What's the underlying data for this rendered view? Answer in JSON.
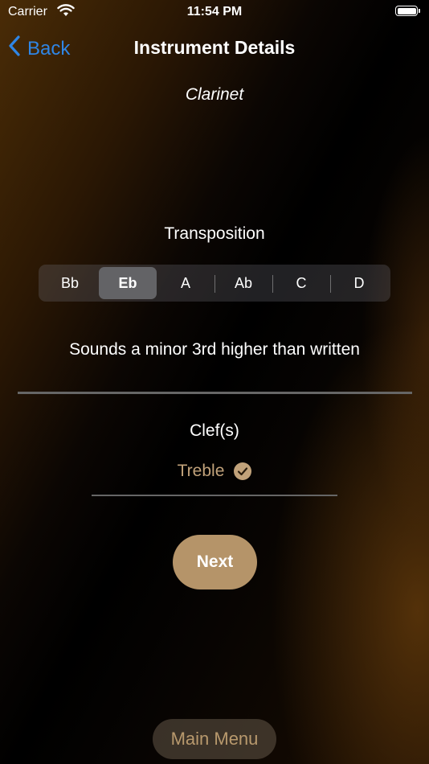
{
  "status_bar": {
    "carrier": "Carrier",
    "time": "11:54 PM"
  },
  "nav": {
    "back_label": "Back",
    "title": "Instrument Details"
  },
  "instrument": "Clarinet",
  "transposition": {
    "label": "Transposition",
    "options": [
      "Bb",
      "Eb",
      "A",
      "Ab",
      "C",
      "D"
    ],
    "selected": "Eb",
    "description": "Sounds a minor 3rd higher than written"
  },
  "clefs": {
    "label": "Clef(s)",
    "items": [
      {
        "name": "Treble",
        "checked": true
      }
    ]
  },
  "next_label": "Next",
  "main_menu_label": "Main Menu",
  "colors": {
    "accent": "#b59469",
    "link": "#2f86e6",
    "clef_text": "#c1a27a"
  },
  "icons": {
    "back": "chevron-left-icon",
    "wifi": "wifi-icon",
    "battery": "battery-icon",
    "check": "checkmark-circle-icon"
  }
}
